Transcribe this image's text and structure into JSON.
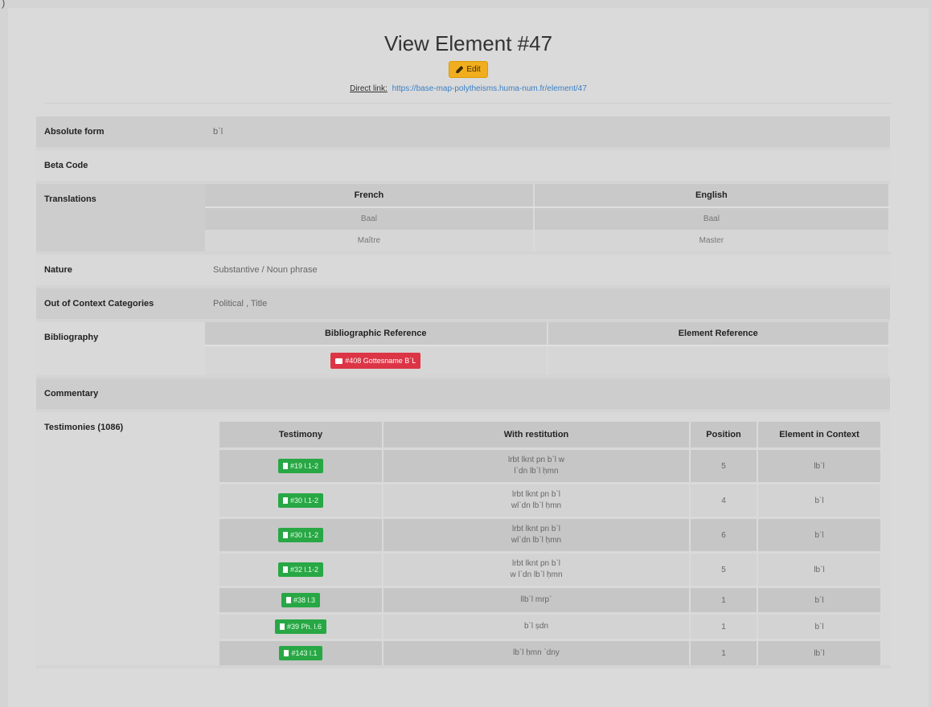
{
  "corner_mark": ")",
  "page": {
    "title": "View Element #47",
    "edit_label": "Edit",
    "direct_link_label": "Direct link:",
    "direct_link_url": "https://base-map-polytheisms.huma-num.fr/element/47"
  },
  "fields": {
    "absolute_form": {
      "label": "Absolute form",
      "value": "b`l"
    },
    "beta_code": {
      "label": "Beta Code",
      "value": ""
    },
    "translations": {
      "label": "Translations",
      "headers": [
        "French",
        "English"
      ],
      "rows": [
        [
          "Baal",
          "Baal"
        ],
        [
          "Maître",
          "Master"
        ]
      ]
    },
    "nature": {
      "label": "Nature",
      "value": "Substantive / Noun phrase"
    },
    "out_of_context": {
      "label": "Out of Context Categories",
      "value": "Political , Title"
    },
    "bibliography": {
      "label": "Bibliography",
      "headers": [
        "Bibliographic Reference",
        "Element Reference"
      ],
      "ref_button": "#408 Gottesname B`L",
      "element_ref": ""
    },
    "commentary": {
      "label": "Commentary",
      "value": ""
    },
    "testimonies": {
      "label": "Testimonies (1086)",
      "headers": [
        "Testimony",
        "With restitution",
        "Position",
        "Element in Context"
      ],
      "rows": [
        {
          "testimony": "#19 l.1-2",
          "restitution": [
            "lrbt lknt pn b`l w",
            "l`dn lb`l ḥmn"
          ],
          "position": "5",
          "context": "lb`l"
        },
        {
          "testimony": "#30 l.1-2",
          "restitution": [
            "lrbt lknt pn b`l",
            "wl`dn lb`l ḥmn"
          ],
          "position": "4",
          "context": "b`l"
        },
        {
          "testimony": "#30 l.1-2",
          "restitution": [
            "lrbt lknt pn b`l",
            "wl`dn lb`l ḥmn"
          ],
          "position": "6",
          "context": "b`l"
        },
        {
          "testimony": "#32 l.1-2",
          "restitution": [
            "lrbt lknt pn b`l",
            "w l`dn lb`l ḥmn"
          ],
          "position": "5",
          "context": "lb`l"
        },
        {
          "testimony": "#38 l.3",
          "restitution": [
            "llb`l mrp`"
          ],
          "position": "1",
          "context": "b`l"
        },
        {
          "testimony": "#39 Ph. l.6",
          "restitution": [
            "b`l ṣdn"
          ],
          "position": "1",
          "context": "b`l"
        },
        {
          "testimony": "#143 l.1",
          "restitution": [
            "lb`l ḥmn `dny"
          ],
          "position": "1",
          "context": "lb`l"
        }
      ]
    }
  },
  "colors": {
    "edit": "#f0ad1e",
    "danger": "#dc3545",
    "success": "#28a745",
    "link": "#3b7fc4"
  }
}
